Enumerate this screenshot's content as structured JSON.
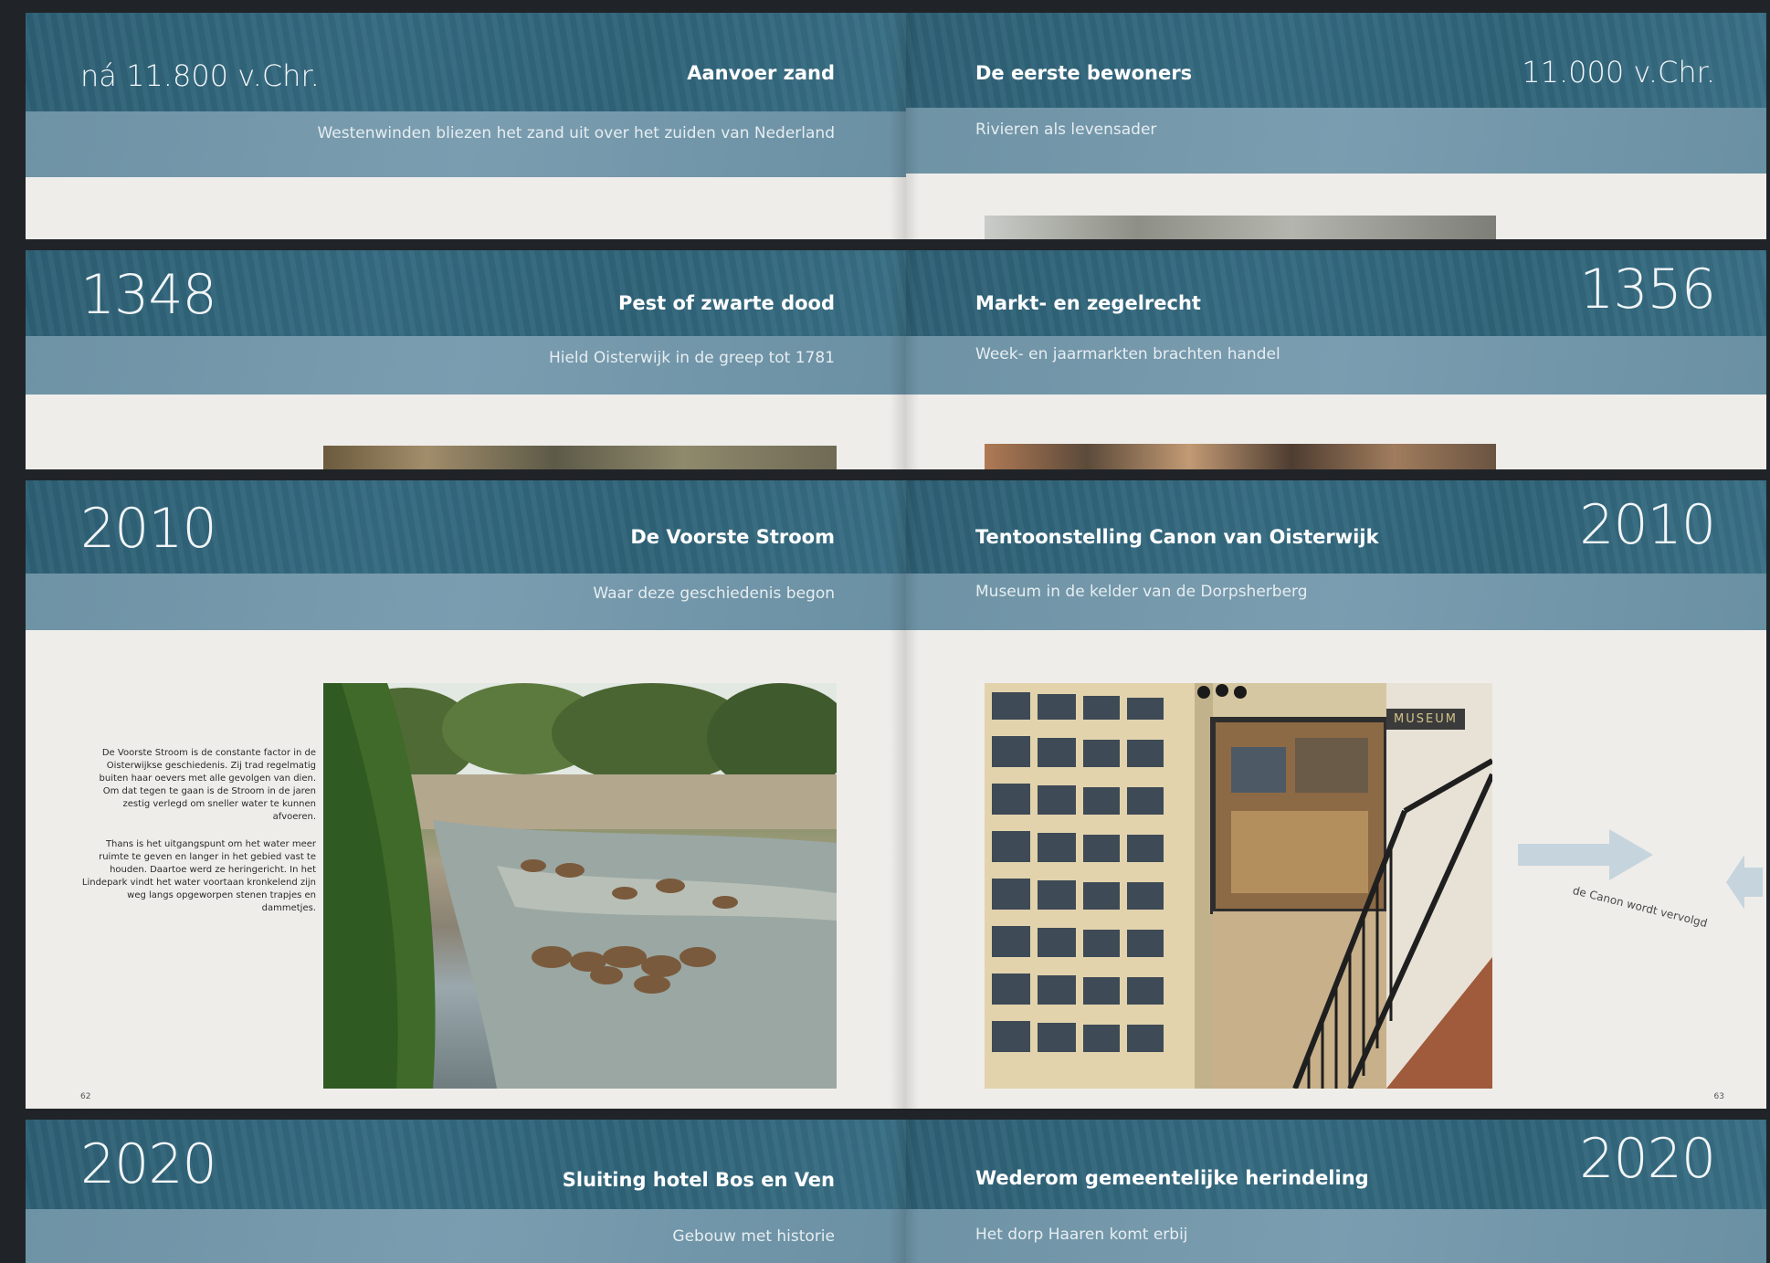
{
  "spreads": [
    {
      "left": {
        "year": "ná 11.800 v.Chr.",
        "title": "Aanvoer zand",
        "subtitle": "Westenwinden bliezen het zand uit over het zuiden van Nederland"
      },
      "right": {
        "year": "11.000 v.Chr.",
        "title": "De eerste bewoners",
        "subtitle": "Rivieren als levensader"
      }
    },
    {
      "left": {
        "year": "1348",
        "title": "Pest of zwarte dood",
        "subtitle": "Hield Oisterwijk in de greep tot 1781"
      },
      "right": {
        "year": "1356",
        "title": "Markt- en zegelrecht",
        "subtitle": "Week- en jaarmarkten brachten handel"
      }
    },
    {
      "left": {
        "year": "2010",
        "title": "De Voorste Stroom",
        "subtitle": "Waar deze geschiedenis begon",
        "paragraph1": "De Voorste Stroom is de constante factor in de Oisterwijkse geschiedenis. Zij trad regelmatig buiten haar oevers met alle gevolgen van dien. Om dat tegen te gaan is de Stroom in de jaren zestig verlegd om sneller water te kunnen afvoeren.",
        "paragraph2": "Thans is het uitgangspunt om het water meer ruimte te geven en langer in het gebied vast te houden. Daartoe werd ze heringericht. In het Lindepark vindt het water voortaan kronkelend zijn weg langs opgeworpen stenen trapjes en dammetjes.",
        "page_number": "62"
      },
      "right": {
        "year": "2010",
        "title": "Tentoonstelling Canon van Oisterwijk",
        "subtitle": "Museum in de kelder van de Dorpsherberg",
        "sign": "MUSEUM",
        "continued": "de Canon wordt vervolgd",
        "page_number": "63"
      }
    },
    {
      "left": {
        "year": "2020",
        "title": "Sluiting hotel Bos en Ven",
        "subtitle": "Gebouw met historie"
      },
      "right": {
        "year": "2020",
        "title": "Wederom gemeentelijke herindeling",
        "subtitle": "Het dorp Haaren komt erbij"
      }
    }
  ]
}
